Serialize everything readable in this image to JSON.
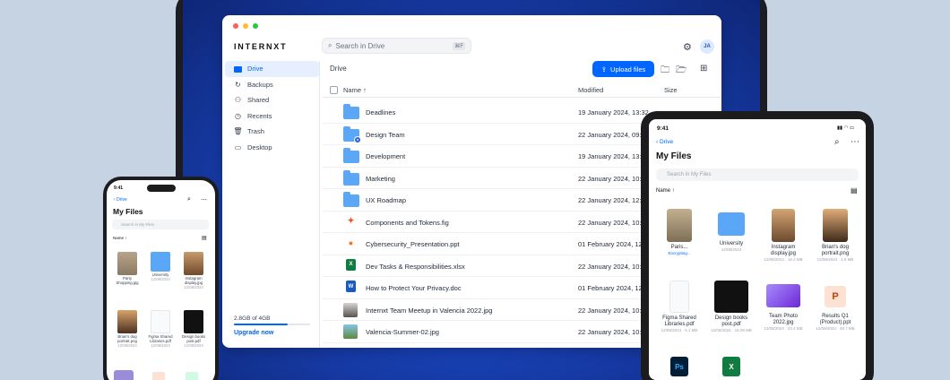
{
  "laptop": {
    "logo": "INTERNXT",
    "search_placeholder": "Search in Drive",
    "search_shortcut": "⌘F",
    "avatar_initials": "JA",
    "sidebar": [
      {
        "label": "Drive",
        "icon": "folder-icon",
        "active": true
      },
      {
        "label": "Backups",
        "icon": "backups-icon"
      },
      {
        "label": "Shared",
        "icon": "users-icon"
      },
      {
        "label": "Recents",
        "icon": "clock-icon"
      },
      {
        "label": "Trash",
        "icon": "trash-icon"
      },
      {
        "label": "Desktop",
        "icon": "desktop-icon"
      }
    ],
    "storage_text": "2.8GB of 4GB",
    "storage_fraction": 0.7,
    "upgrade_label": "Upgrade now",
    "breadcrumb": "Drive",
    "upload_label": "Upload files",
    "columns": {
      "name": "Name ↑",
      "modified": "Modified",
      "size": "Size"
    },
    "files": [
      {
        "name": "Deadlines",
        "type": "folder",
        "modified": "19 January 2024, 13:32"
      },
      {
        "name": "Design Team",
        "type": "shared-folder",
        "modified": "22 January 2024, 09:29"
      },
      {
        "name": "Development",
        "type": "folder",
        "modified": "19 January 2024, 13:34"
      },
      {
        "name": "Marketing",
        "type": "folder",
        "modified": "22 January 2024, 10:08"
      },
      {
        "name": "UX Roadmap",
        "type": "folder",
        "modified": "22 January 2024, 12:44"
      },
      {
        "name": "Components and Tokens.fig",
        "type": "fig",
        "modified": "22 January 2024, 10:08"
      },
      {
        "name": "Cybersecurity_Presentation.ppt",
        "type": "ppt",
        "modified": "01 February 2024, 12:31"
      },
      {
        "name": "Dev Tasks & Responsibilities.xlsx",
        "type": "xlsx",
        "modified": "22 January 2024, 10:08"
      },
      {
        "name": "How to Protect Your Privacy.doc",
        "type": "doc",
        "modified": "01 February 2024, 12:25"
      },
      {
        "name": "Internxt Team Meetup in Valencia 2022.jpg",
        "type": "photo",
        "modified": "22 January 2024, 10:08"
      },
      {
        "name": "Valencia-Summer-02.jpg",
        "type": "photo2",
        "modified": "22 January 2024, 10:08"
      }
    ]
  },
  "phone": {
    "time": "9:41",
    "back": "Drive",
    "title": "My Files",
    "search_placeholder": "Search in My Files",
    "sort": "Name ↑",
    "items": [
      {
        "name": "Party Shopping.jpg",
        "sub": "12/08/2024"
      },
      {
        "name": "University",
        "sub": "12/08/2024"
      },
      {
        "name": "Instagram display.jpg",
        "sub": "12/08/2024"
      },
      {
        "name": "Brian's dog portrait.png",
        "sub": "12/08/2024"
      },
      {
        "name": "Figma Shared Libraries.pdf",
        "sub": "12/08/2024"
      },
      {
        "name": "Design books post.pdf",
        "sub": "12/08/2024"
      }
    ]
  },
  "tablet": {
    "time": "9:41",
    "back": "Drive",
    "title": "My Files",
    "search_placeholder": "Search in My Files",
    "sort": "Name ↑",
    "items": [
      {
        "name": "Paris...",
        "sub": "Encrypting..."
      },
      {
        "name": "University",
        "sub": "12/08/2024"
      },
      {
        "name": "Instagram display.jpg",
        "sub": "12/08/2024 · 16.2 MB"
      },
      {
        "name": "Brian's dog portrait.png",
        "sub": "12/08/2024 · 1.6 MB"
      },
      {
        "name": "Figma Shared Libraries.pdf",
        "sub": "12/08/2024 · 5.1 MB"
      },
      {
        "name": "Design books post.pdf",
        "sub": "12/08/2024 · 18.09 MB"
      },
      {
        "name": "Team Photo 2022.jpg",
        "sub": "12/08/2024 · 23.4 MB"
      },
      {
        "name": "Results Q1 (Product).ppt",
        "sub": "12/08/2024 · 48.7 MB"
      }
    ]
  }
}
